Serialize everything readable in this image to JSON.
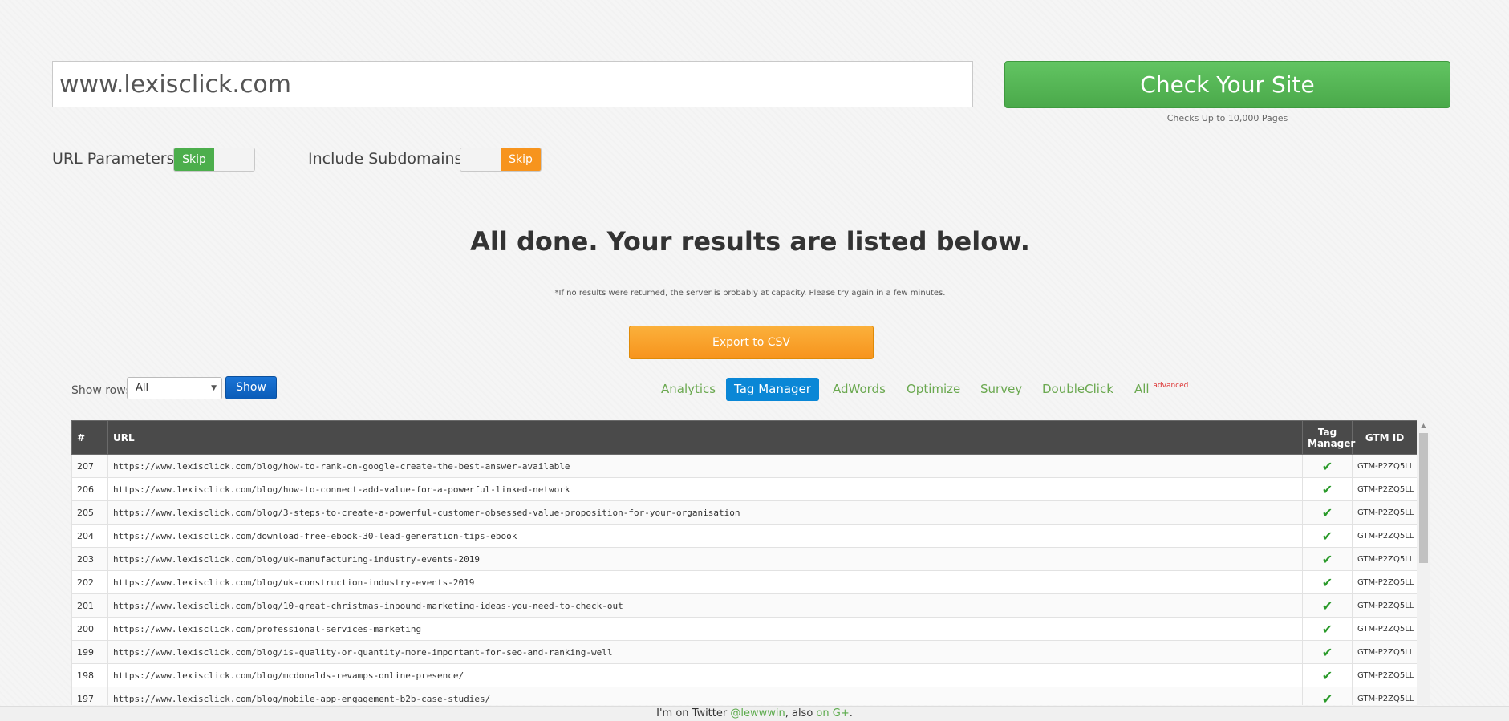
{
  "search": {
    "value": "www.lexisclick.com",
    "button_label": "Check Your Site",
    "note": "Checks Up to 10,000 Pages"
  },
  "options": [
    {
      "label": "URL Parameters:",
      "toggle": "Skip",
      "color": "#4cae4c"
    },
    {
      "label": "Include Subdomains:",
      "toggle": "Skip",
      "color": "#f7941d"
    }
  ],
  "results": {
    "headline": "All done. Your results are listed below.",
    "note": "*If no results were returned, the server is probably at capacity. Please try again in a few minutes.",
    "export_label": "Export to CSV"
  },
  "rows_control": {
    "label": "Show rows",
    "selected": "All",
    "button": "Show"
  },
  "tabs": [
    {
      "label": "Analytics",
      "active": false
    },
    {
      "label": "Tag Manager",
      "active": true
    },
    {
      "label": "AdWords",
      "active": false
    },
    {
      "label": "Optimize",
      "active": false
    },
    {
      "label": "Survey",
      "active": false
    },
    {
      "label": "DoubleClick",
      "active": false
    },
    {
      "label": "All",
      "sup": "advanced",
      "active": false
    }
  ],
  "table": {
    "headers": {
      "num": "#",
      "url": "URL",
      "tag": "Tag Manager",
      "gtm": "GTM ID"
    },
    "rows": [
      {
        "num": "207",
        "url": "https://www.lexisclick.com/blog/how-to-rank-on-google-create-the-best-answer-available",
        "tag": "✔",
        "gtm": "GTM-P2ZQ5LL"
      },
      {
        "num": "206",
        "url": "https://www.lexisclick.com/blog/how-to-connect-add-value-for-a-powerful-linked-network",
        "tag": "✔",
        "gtm": "GTM-P2ZQ5LL"
      },
      {
        "num": "205",
        "url": "https://www.lexisclick.com/blog/3-steps-to-create-a-powerful-customer-obsessed-value-proposition-for-your-organisation",
        "tag": "✔",
        "gtm": "GTM-P2ZQ5LL"
      },
      {
        "num": "204",
        "url": "https://www.lexisclick.com/download-free-ebook-30-lead-generation-tips-ebook",
        "tag": "✔",
        "gtm": "GTM-P2ZQ5LL"
      },
      {
        "num": "203",
        "url": "https://www.lexisclick.com/blog/uk-manufacturing-industry-events-2019",
        "tag": "✔",
        "gtm": "GTM-P2ZQ5LL"
      },
      {
        "num": "202",
        "url": "https://www.lexisclick.com/blog/uk-construction-industry-events-2019",
        "tag": "✔",
        "gtm": "GTM-P2ZQ5LL"
      },
      {
        "num": "201",
        "url": "https://www.lexisclick.com/blog/10-great-christmas-inbound-marketing-ideas-you-need-to-check-out",
        "tag": "✔",
        "gtm": "GTM-P2ZQ5LL"
      },
      {
        "num": "200",
        "url": "https://www.lexisclick.com/professional-services-marketing",
        "tag": "✔",
        "gtm": "GTM-P2ZQ5LL"
      },
      {
        "num": "199",
        "url": "https://www.lexisclick.com/blog/is-quality-or-quantity-more-important-for-seo-and-ranking-well",
        "tag": "✔",
        "gtm": "GTM-P2ZQ5LL"
      },
      {
        "num": "198",
        "url": "https://www.lexisclick.com/blog/mcdonalds-revamps-online-presence/",
        "tag": "✔",
        "gtm": "GTM-P2ZQ5LL"
      },
      {
        "num": "197",
        "url": "https://www.lexisclick.com/blog/mobile-app-engagement-b2b-case-studies/",
        "tag": "✔",
        "gtm": "GTM-P2ZQ5LL"
      }
    ]
  },
  "footer": {
    "prefix": "I'm on Twitter ",
    "twitter": "@lewwwin",
    "middle": ", also ",
    "gplus": "on G+",
    "suffix": "."
  }
}
